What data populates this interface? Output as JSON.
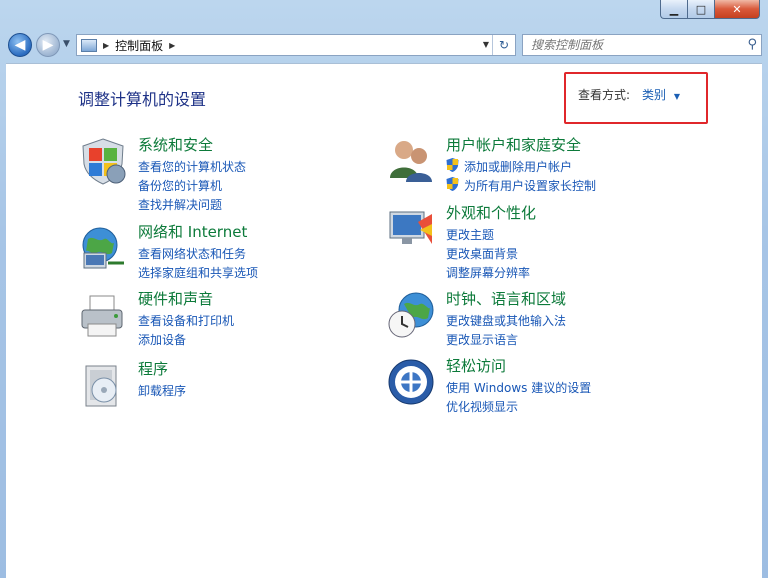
{
  "window": {
    "minimize": "▁",
    "maximize": "□",
    "close": "✕"
  },
  "nav": {
    "back_icon": "back-arrow-icon",
    "forward_icon": "forward-arrow-icon",
    "breadcrumb": "控制面板",
    "search_placeholder": "搜索控制面板"
  },
  "heading": "调整计算机的设置",
  "view": {
    "label": "查看方式:",
    "value": "类别"
  },
  "categories": [
    {
      "title": "系统和安全",
      "links": [
        "查看您的计算机状态",
        "备份您的计算机",
        "查找并解决问题"
      ]
    },
    {
      "title": "网络和 Internet",
      "links": [
        "查看网络状态和任务",
        "选择家庭组和共享选项"
      ]
    },
    {
      "title": "硬件和声音",
      "links": [
        "查看设备和打印机",
        "添加设备"
      ]
    },
    {
      "title": "程序",
      "links": [
        "卸载程序"
      ]
    },
    {
      "title": "用户帐户和家庭安全",
      "links": [
        "添加或删除用户帐户",
        "为所有用户设置家长控制"
      ]
    },
    {
      "title": "外观和个性化",
      "links": [
        "更改主题",
        "更改桌面背景",
        "调整屏幕分辨率"
      ]
    },
    {
      "title": "时钟、语言和区域",
      "links": [
        "更改键盘或其他输入法",
        "更改显示语言"
      ]
    },
    {
      "title": "轻松访问",
      "links": [
        "使用 Windows 建议的设置",
        "优化视频显示"
      ]
    }
  ],
  "colors": {
    "title_green": "#0c7a3a",
    "link_blue": "#1957b6",
    "heading_blue": "#1e3287",
    "highlight_red": "#e0272b"
  }
}
